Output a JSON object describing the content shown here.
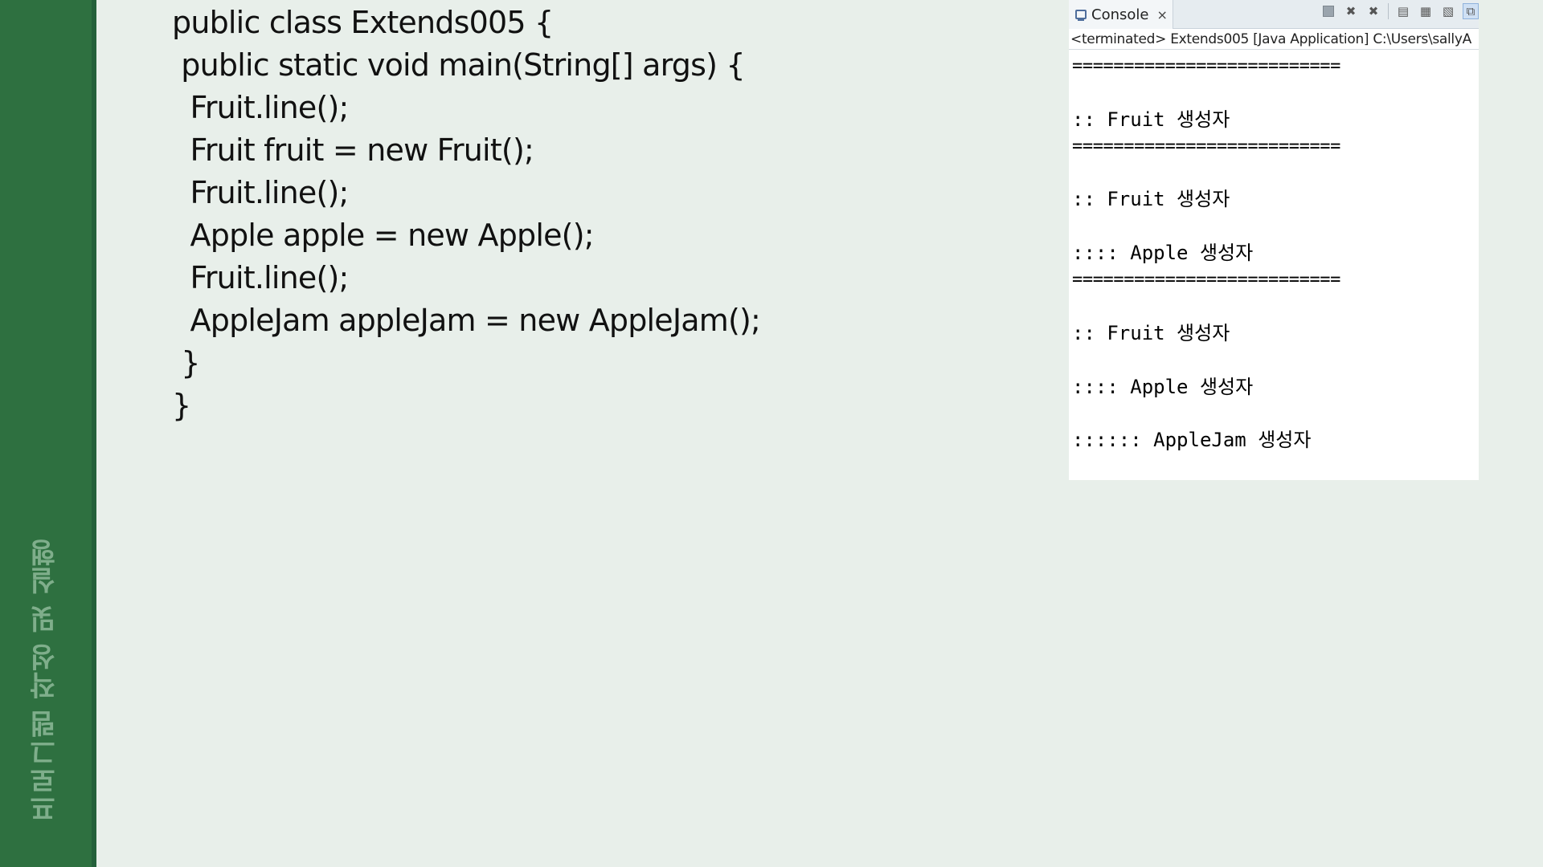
{
  "sidebar": {
    "label": "프로그램 작성 및 실행"
  },
  "code": {
    "lines": [
      "public class Extends005 {",
      " public static void main(String[] args) {",
      "  Fruit.line();",
      "  Fruit fruit = new Fruit();",
      "  Fruit.line();",
      "  Apple apple = new Apple();",
      "  Fruit.line();",
      "  AppleJam appleJam = new AppleJam();",
      " }",
      "}"
    ]
  },
  "console": {
    "tab_label": "Console",
    "tab_close": "×",
    "status": "<terminated> Extends005 [Java Application] C:\\Users\\sallyA",
    "output": [
      "==========================",
      "",
      ":: Fruit 생성자",
      "==========================",
      "",
      ":: Fruit 생성자",
      "",
      ":::: Apple 생성자",
      "==========================",
      "",
      ":: Fruit 생성자",
      "",
      ":::: Apple 생성자",
      "",
      ":::::: AppleJam 생성자"
    ],
    "tools": {
      "terminate_icon": "stop-square-icon",
      "remove_icon": "remove-launch-icon",
      "remove_all_icon": "remove-all-icon",
      "clear_icon": "clear-console-icon",
      "scroll_lock_icon": "scroll-lock-icon",
      "pin_icon": "pin-console-icon",
      "display_icon": "display-console-icon"
    }
  }
}
